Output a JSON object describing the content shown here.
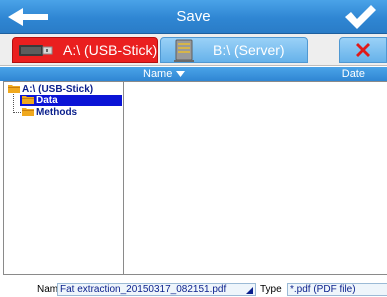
{
  "header": {
    "title": "Save",
    "back_icon": "arrow-left-icon",
    "confirm_icon": "checkmark-icon"
  },
  "drives": {
    "tabs": [
      {
        "label": "A:\\ (USB-Stick)",
        "icon": "usb-stick-icon",
        "active": true
      },
      {
        "label": "B:\\ (Server)",
        "icon": "server-icon",
        "active": false
      }
    ],
    "delete_icon": "delete-x-icon"
  },
  "columns": {
    "name": "Name",
    "date": "Date",
    "sort_icon": "sort-down-icon"
  },
  "tree": {
    "root": "A:\\ (USB-Stick)",
    "children": [
      {
        "label": "Data",
        "selected": true
      },
      {
        "label": "Methods",
        "selected": false
      }
    ]
  },
  "save_form": {
    "name_label": "Name",
    "name_value": "Fat extraction_20150317_082151.pdf",
    "type_label": "Type",
    "type_value": "*.pdf (PDF file)"
  },
  "colors": {
    "accent_blue": "#2f86d3",
    "active_red": "#ea1f1f",
    "selection": "#0b14d6",
    "folder": "#f0a91e"
  }
}
